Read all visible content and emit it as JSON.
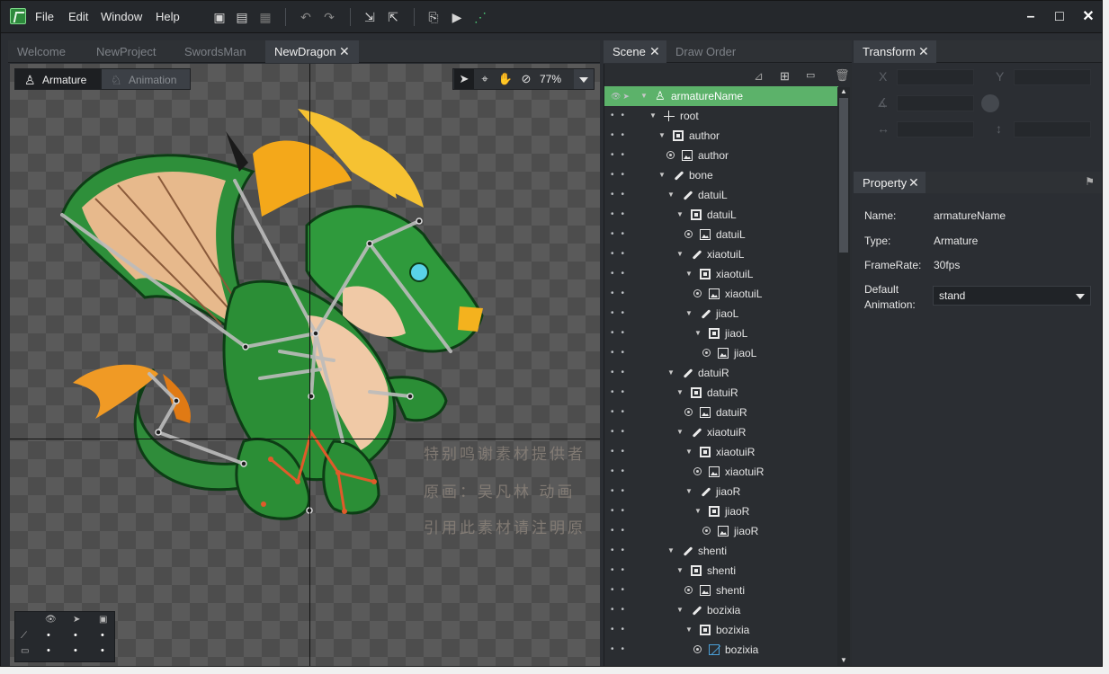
{
  "menu": [
    "File",
    "Edit",
    "Window",
    "Help"
  ],
  "doc_tabs": [
    "Welcome",
    "NewProject",
    "SwordsMan",
    "NewDragon"
  ],
  "modes": {
    "armature": "Armature",
    "animation": "Animation"
  },
  "zoom": "77%",
  "watermark_lines": [
    "特别鸣谢素材提供者",
    "原画：吴凡林 动画",
    "引用此素材请注明原"
  ],
  "scene_tabs": {
    "scene": "Scene",
    "draw_order": "Draw Order"
  },
  "tree": [
    {
      "label": "armatureName",
      "type": "armature",
      "depth": 0,
      "selected": true
    },
    {
      "label": "root",
      "type": "root",
      "depth": 1
    },
    {
      "label": "author",
      "type": "slot",
      "depth": 2
    },
    {
      "label": "author",
      "type": "image",
      "depth": 3
    },
    {
      "label": "bone",
      "type": "bone",
      "depth": 2
    },
    {
      "label": "datuiL",
      "type": "bone",
      "depth": 3
    },
    {
      "label": "datuiL",
      "type": "slot",
      "depth": 4
    },
    {
      "label": "datuiL",
      "type": "image",
      "depth": 5
    },
    {
      "label": "xiaotuiL",
      "type": "bone",
      "depth": 4
    },
    {
      "label": "xiaotuiL",
      "type": "slot",
      "depth": 5
    },
    {
      "label": "xiaotuiL",
      "type": "image",
      "depth": 6
    },
    {
      "label": "jiaoL",
      "type": "bone",
      "depth": 5
    },
    {
      "label": "jiaoL",
      "type": "slot",
      "depth": 6
    },
    {
      "label": "jiaoL",
      "type": "image",
      "depth": 7
    },
    {
      "label": "datuiR",
      "type": "bone",
      "depth": 3
    },
    {
      "label": "datuiR",
      "type": "slot",
      "depth": 4
    },
    {
      "label": "datuiR",
      "type": "image",
      "depth": 5
    },
    {
      "label": "xiaotuiR",
      "type": "bone",
      "depth": 4
    },
    {
      "label": "xiaotuiR",
      "type": "slot",
      "depth": 5
    },
    {
      "label": "xiaotuiR",
      "type": "image",
      "depth": 6
    },
    {
      "label": "jiaoR",
      "type": "bone",
      "depth": 5
    },
    {
      "label": "jiaoR",
      "type": "slot",
      "depth": 6
    },
    {
      "label": "jiaoR",
      "type": "image",
      "depth": 7
    },
    {
      "label": "shenti",
      "type": "bone",
      "depth": 3
    },
    {
      "label": "shenti",
      "type": "slot",
      "depth": 4
    },
    {
      "label": "shenti",
      "type": "image",
      "depth": 5
    },
    {
      "label": "bozixia",
      "type": "bone",
      "depth": 4
    },
    {
      "label": "bozixia",
      "type": "slot",
      "depth": 5
    },
    {
      "label": "bozixia",
      "type": "mesh",
      "depth": 6
    }
  ],
  "transform": {
    "title": "Transform",
    "x_label": "X",
    "y_label": "Y"
  },
  "property": {
    "title": "Property",
    "name_label": "Name:",
    "name_value": "armatureName",
    "type_label": "Type:",
    "type_value": "Armature",
    "framerate_label": "FrameRate:",
    "framerate_value": "30fps",
    "default_anim_label_1": "Default",
    "default_anim_label_2": "Animation:",
    "default_anim_value": "stand"
  }
}
